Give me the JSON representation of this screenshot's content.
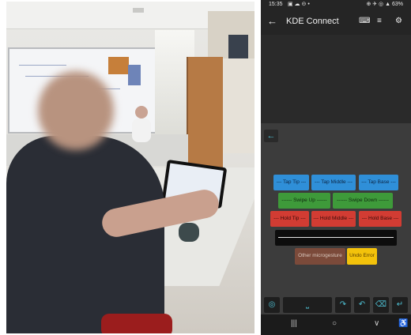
{
  "status_bar": {
    "time": "15:35",
    "icons": "▣ ☁ ⊝ •",
    "right": "⊕ ✈ ◎ ▲ 63%"
  },
  "app_bar": {
    "title": "KDE Connect",
    "back_icon": "arrow-left-icon",
    "icons": [
      "keyboard-icon",
      "list-edit-icon",
      "gear-icon"
    ]
  },
  "keyboard": {
    "back_icon": "arrow-left-icon",
    "rows": [
      [
        "--- Tap Tip ---",
        "--- Tap Middle ---",
        "--- Tap Base ---"
      ],
      [
        "------ Swipe Up ------",
        "------ Swipe Down ------"
      ],
      [
        "--- Hold Tip ---",
        "--- Hold Middle ---",
        "--- Hold Base ---"
      ]
    ],
    "other_label": "Other microgesture",
    "undo_label": "Undo Error",
    "bottom_icons": [
      "globe-icon",
      "space-icon",
      "redo-icon",
      "undo-icon",
      "backspace-icon",
      "enter-icon"
    ],
    "colors": {
      "tap": "#2f8fd8",
      "swipe": "#3e9a3a",
      "hold": "#d23c33",
      "other": "#7b4a3a",
      "undo": "#f3c20b"
    }
  },
  "nav_bar": {
    "icons": [
      "recents-icon",
      "home-icon",
      "back-chevron-icon",
      "accessibility-icon"
    ]
  }
}
